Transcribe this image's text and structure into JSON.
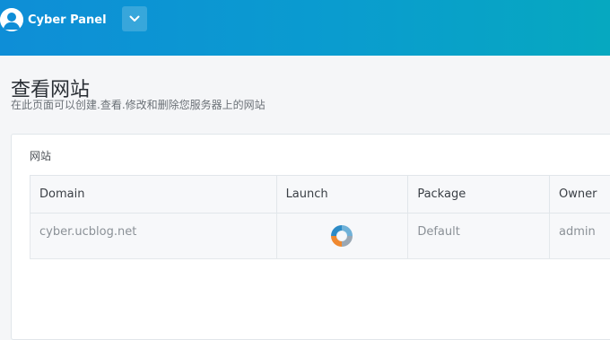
{
  "header": {
    "brand": "Cyber Panel",
    "menu_icon": "chevron-down-icon",
    "avatar_icon": "user-avatar-icon",
    "gradient_start": "#0e8ed7",
    "gradient_end": "#06a8c0"
  },
  "page": {
    "title": "查看网站",
    "subtitle": "在此页面可以创建.查看.修改和删除您服务器上的网站"
  },
  "panel": {
    "title": "网站",
    "columns": [
      "Domain",
      "Launch",
      "Package",
      "Owner"
    ],
    "rows": [
      {
        "domain": "cyber.ucblog.net",
        "launch_icon": "launch-icon",
        "package": "Default",
        "owner": "admin"
      }
    ]
  }
}
